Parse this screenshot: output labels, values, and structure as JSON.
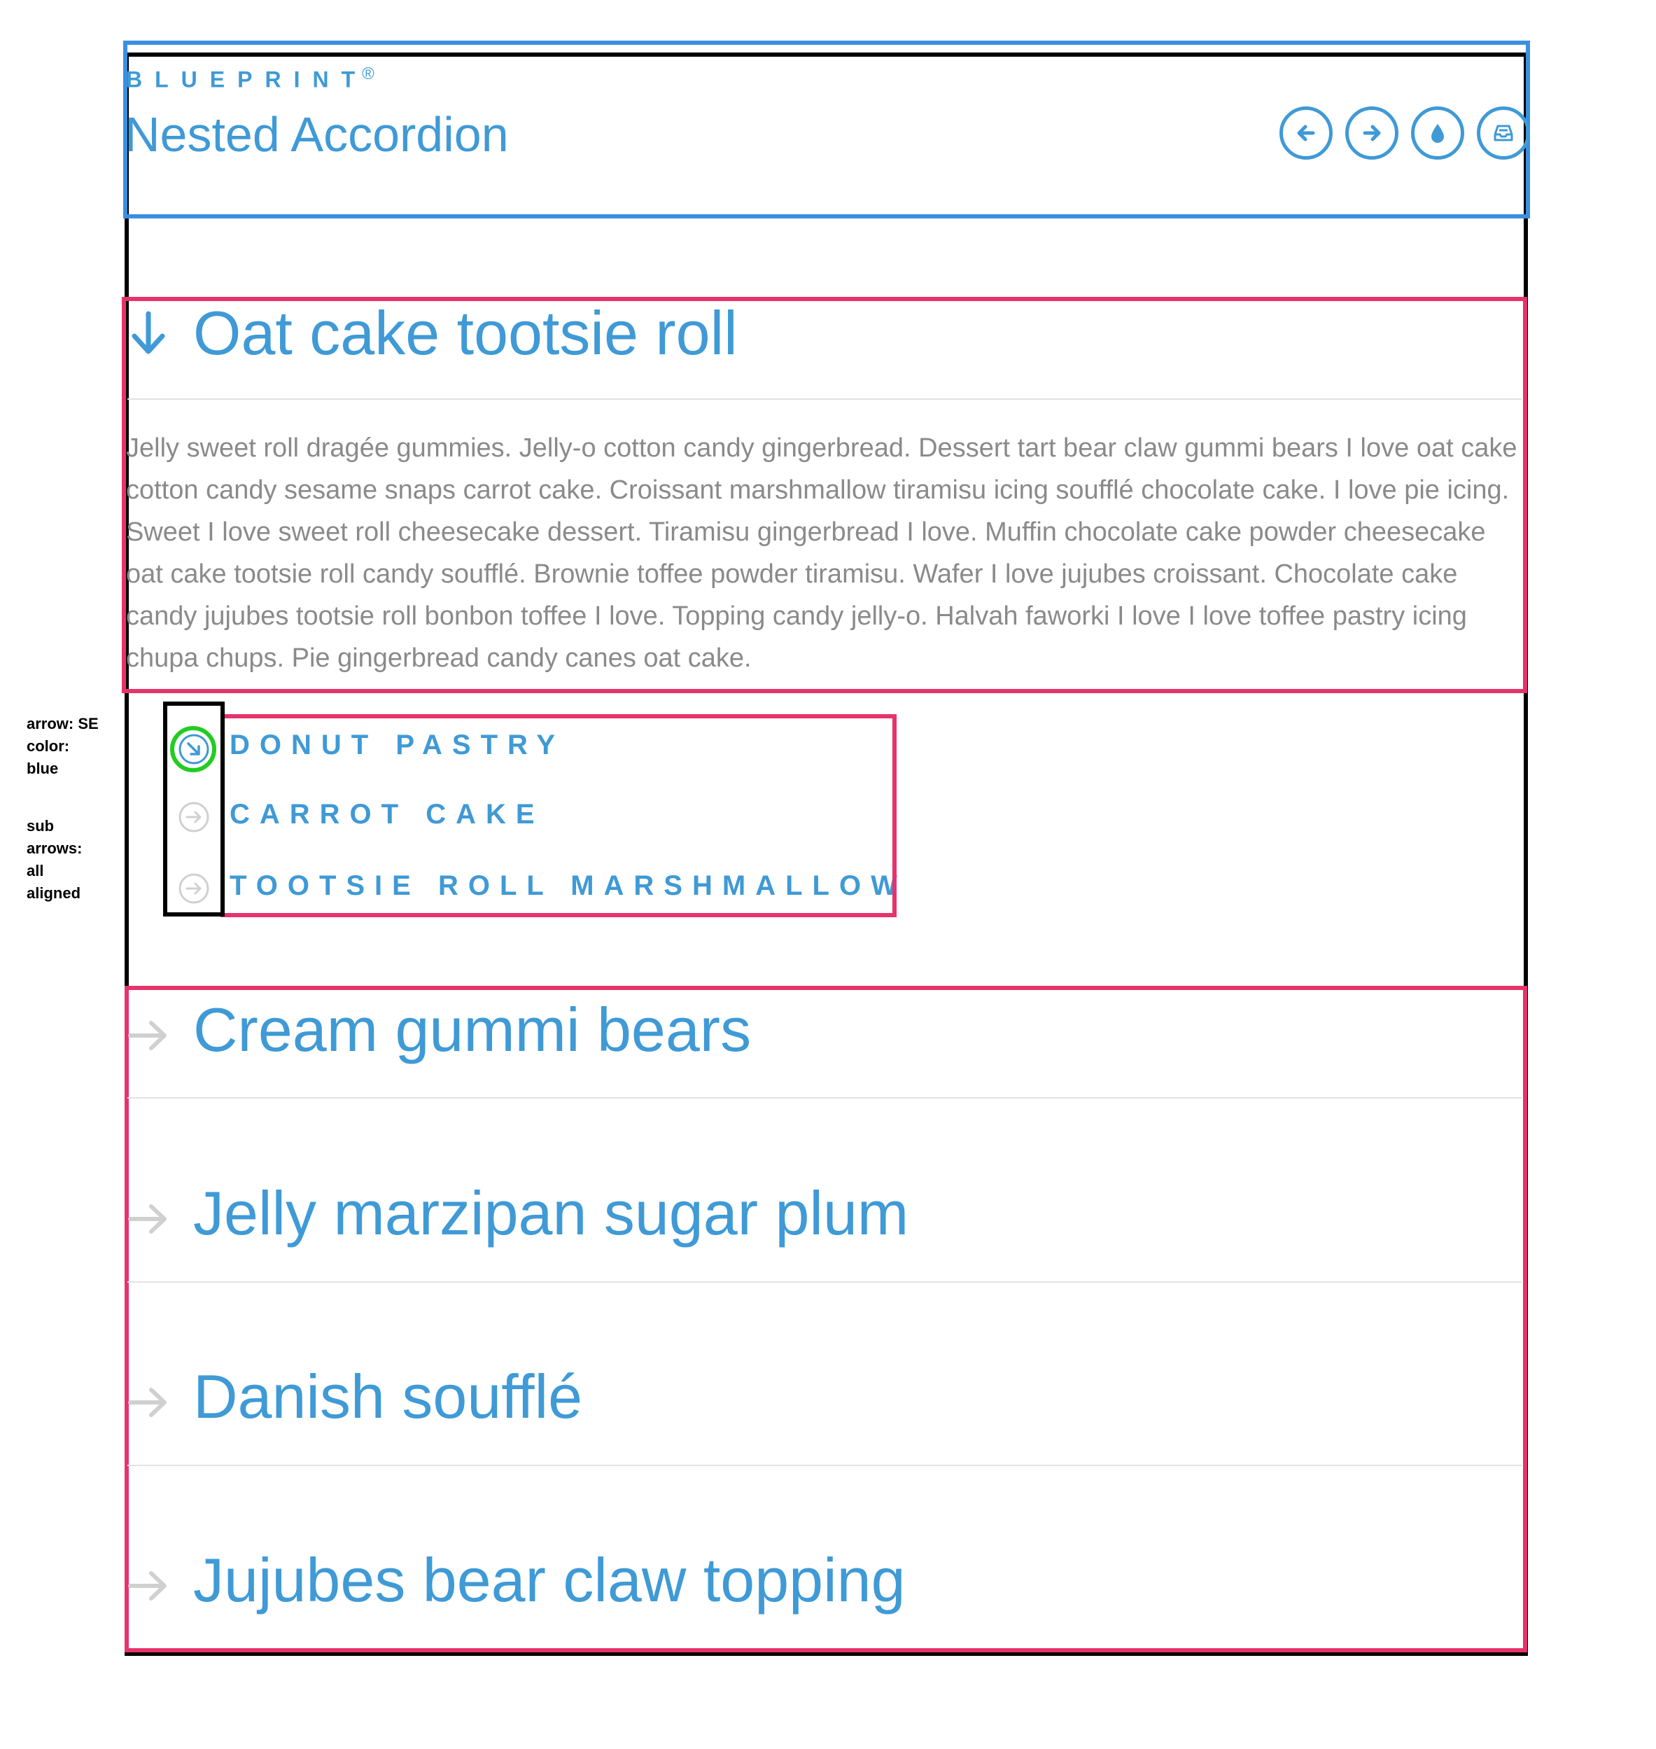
{
  "header": {
    "brand": "BLUEPRINT",
    "brand_mark": "®",
    "title": "Nested Accordion",
    "buttons": [
      {
        "name": "back-button",
        "icon": "arrow-left-icon"
      },
      {
        "name": "forward-button",
        "icon": "arrow-right-icon"
      },
      {
        "name": "drop-button",
        "icon": "droplet-icon"
      },
      {
        "name": "inbox-button",
        "icon": "inbox-icon"
      }
    ]
  },
  "sections": [
    {
      "title": "Oat cake tootsie roll",
      "expanded": true,
      "body": "Jelly sweet roll dragée gummies. Jelly-o cotton candy gingerbread. Dessert tart bear claw gummi bears I love oat cake cotton candy sesame snaps carrot cake. Croissant marshmallow tiramisu icing soufflé chocolate cake. I love pie icing. Sweet I love sweet roll cheesecake dessert. Tiramisu gingerbread I love. Muffin chocolate cake powder cheesecake oat cake tootsie roll candy soufflé. Brownie toffee powder tiramisu. Wafer I love jujubes croissant. Chocolate cake candy jujubes tootsie roll bonbon toffee I love. Topping candy jelly-o. Halvah faworki I love I love toffee pastry icing chupa chups. Pie gingerbread candy canes oat cake.",
      "subitems": [
        {
          "label": "DONUT PASTRY",
          "active": true
        },
        {
          "label": "CARROT CAKE",
          "active": false
        },
        {
          "label": "TOOTSIE ROLL MARSHMALLOW",
          "active": false
        }
      ]
    },
    {
      "title": "Cream gummi bears",
      "expanded": false
    },
    {
      "title": "Jelly marzipan sugar plum",
      "expanded": false
    },
    {
      "title": "Danish soufflé",
      "expanded": false
    },
    {
      "title": "Jujubes bear claw topping",
      "expanded": false
    }
  ],
  "annotation": {
    "line1": "arrow: SE",
    "line2": "color:",
    "line3": "blue",
    "line4": "sub",
    "line5": "arrows:",
    "line6": "all",
    "line7": "aligned"
  },
  "colors": {
    "accent": "#3f9ad6",
    "muted_arrow": "#d0d0d0",
    "body_text": "#8a8a8a",
    "frame_blue": "#3a8fe0",
    "frame_pink": "#e6336b",
    "frame_black": "#000000",
    "highlight_green": "#22cc22"
  }
}
